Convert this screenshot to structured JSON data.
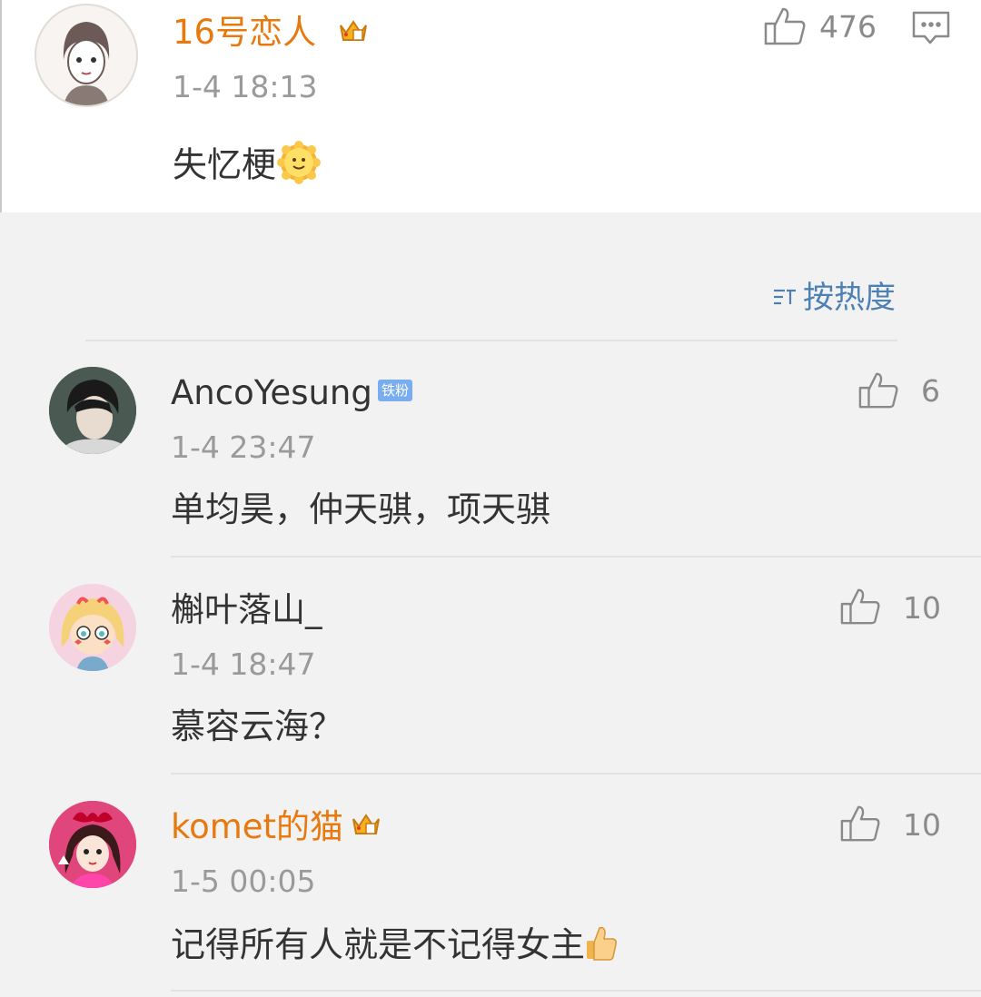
{
  "post": {
    "user_name": "16号恋人",
    "time": "1-4 18:13",
    "content": "失忆梗",
    "like_count": "476"
  },
  "sort": {
    "label": "按热度"
  },
  "comments": [
    {
      "user_name": "AncoYesung",
      "badge": "铁粉",
      "time": "1-4 23:47",
      "content": "单均昊，仲天骐，项天骐",
      "like_count": "6"
    },
    {
      "user_name": "槲叶落山_",
      "time": "1-4 18:47",
      "content": "慕容云海？",
      "like_count": "10"
    },
    {
      "user_name": "komet的猫",
      "time": "1-5 00:05",
      "content": "记得所有人就是不记得女主",
      "like_count": "10"
    }
  ],
  "colors": {
    "vip_name": "#e8790f",
    "link_blue": "#4e80b3",
    "fan_badge": "#78aef0"
  }
}
